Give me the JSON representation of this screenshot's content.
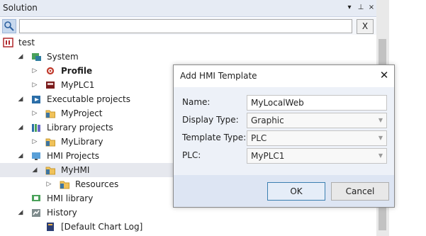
{
  "panel": {
    "title": "Solution",
    "header_buttons": [
      "▾",
      "⊥",
      "×"
    ]
  },
  "search": {
    "value": "",
    "clear_label": "X"
  },
  "tree": [
    {
      "label": "test",
      "expander": "",
      "icon": "solution-icon",
      "bold": false,
      "selected": false
    },
    {
      "label": "System",
      "expander": "◢",
      "icon": "system-icon",
      "bold": false,
      "selected": false
    },
    {
      "label": "Profile",
      "expander": "▷",
      "icon": "gear-icon",
      "bold": true,
      "selected": false
    },
    {
      "label": "MyPLC1",
      "expander": "▷",
      "icon": "plc-icon",
      "bold": false,
      "selected": false
    },
    {
      "label": "Executable projects",
      "expander": "◢",
      "icon": "executable-projects-icon",
      "bold": false,
      "selected": false
    },
    {
      "label": "MyProject",
      "expander": "▷",
      "icon": "folder-icon",
      "bold": false,
      "selected": false
    },
    {
      "label": "Library projects",
      "expander": "◢",
      "icon": "library-icon",
      "bold": false,
      "selected": false
    },
    {
      "label": "MyLibrary",
      "expander": "▷",
      "icon": "folder-icon",
      "bold": false,
      "selected": false
    },
    {
      "label": "HMI Projects",
      "expander": "◢",
      "icon": "hmi-projects-icon",
      "bold": false,
      "selected": false
    },
    {
      "label": "MyHMI",
      "expander": "◢",
      "icon": "folder-icon",
      "bold": false,
      "selected": true
    },
    {
      "label": "Resources",
      "expander": "▷",
      "icon": "folder-icon",
      "bold": false,
      "selected": false
    },
    {
      "label": "HMI library",
      "expander": "",
      "icon": "hmi-library-icon",
      "bold": false,
      "selected": false
    },
    {
      "label": "History",
      "expander": "◢",
      "icon": "history-icon",
      "bold": false,
      "selected": false
    },
    {
      "label": "[Default Chart Log]",
      "expander": "",
      "icon": "chart-log-icon",
      "bold": false,
      "selected": false
    }
  ],
  "dialog": {
    "title": "Add HMI Template",
    "close": "✕",
    "fields": [
      {
        "label": "Name:",
        "value": "MyLocalWeb",
        "type": "text"
      },
      {
        "label": "Display Type:",
        "value": "Graphic",
        "type": "dropdown"
      },
      {
        "label": "Template Type:",
        "value": "PLC",
        "type": "dropdown"
      },
      {
        "label": "PLC:",
        "value": "MyPLC1",
        "type": "dropdown"
      }
    ],
    "ok_label": "OK",
    "cancel_label": "Cancel"
  }
}
